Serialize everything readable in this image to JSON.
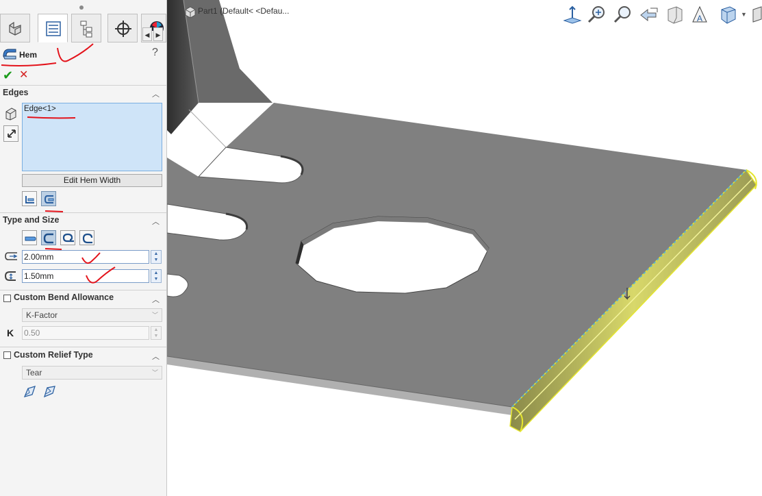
{
  "feature": {
    "title": "Hem",
    "help": "?"
  },
  "actions": {
    "ok": "✔",
    "cancel": "✕"
  },
  "edges": {
    "section": "Edges",
    "items": [
      "Edge<1>"
    ],
    "edit_button": "Edit Hem Width"
  },
  "type_size": {
    "section": "Type and Size",
    "length": "2.00mm",
    "gap": "1.50mm"
  },
  "bend_allowance": {
    "label": "Custom Bend Allowance",
    "method": "K-Factor",
    "k_symbol": "K",
    "k_value": "0.50"
  },
  "relief": {
    "label": "Custom Relief Type",
    "type": "Tear"
  },
  "document": {
    "breadcrumb": "Part1  (Default< <Defau..."
  },
  "icons": {
    "tabs": [
      "feature-manager-icon",
      "property-manager-icon",
      "configuration-manager-icon",
      "dimxpert-icon",
      "appearance-icon"
    ],
    "toolbar": [
      "view-normal-icon",
      "zoom-to-fit-icon",
      "zoom-to-area-icon",
      "previous-view-icon",
      "section-view-icon",
      "dynamic-annotation-icon",
      "view-orientation-icon",
      "display-style-icon"
    ]
  },
  "colors": {
    "sheet_top": "#7f7f7f",
    "sheet_edge": "#a9a9a9",
    "highlight": "#e6e62e",
    "annotation": "#e3131b",
    "checkmark": "#1a9b1a"
  }
}
